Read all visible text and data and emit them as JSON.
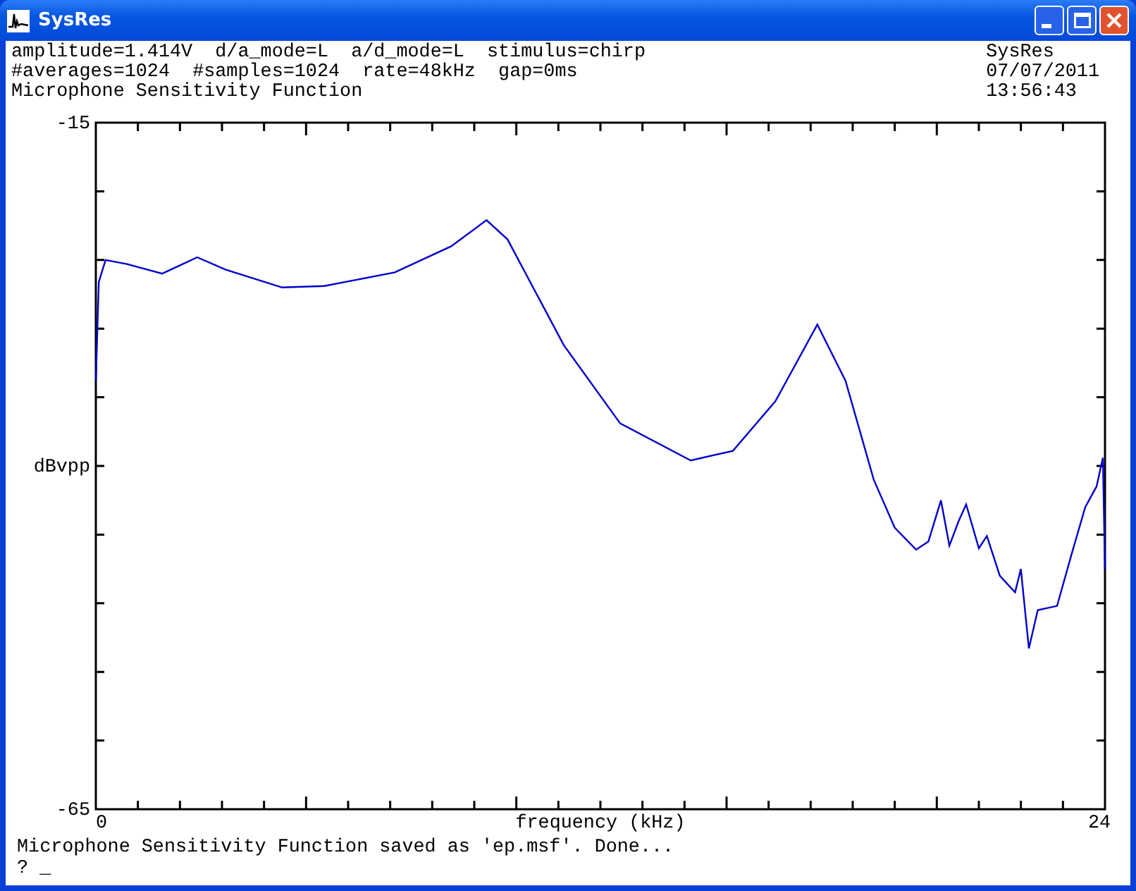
{
  "window": {
    "title": "SysRes"
  },
  "header": {
    "left": [
      "amplitude=1.414V  d/a_mode=L  a/d_mode=L  stimulus=chirp",
      "#averages=1024  #samples=1024  rate=48kHz  gap=0ms",
      "Microphone Sensitivity Function"
    ],
    "right": [
      "SysRes",
      "07/07/2011",
      "13:56:43"
    ]
  },
  "plot": {
    "chart_data": {
      "type": "line",
      "xlabel": "frequency (kHz)",
      "ylabel": "dBvpp",
      "xlim": [
        0,
        24
      ],
      "ylim": [
        -65,
        -15
      ],
      "xticks": [
        0,
        24
      ],
      "yticks": [
        -15,
        -65
      ],
      "x": [
        0,
        0.07,
        0.23,
        0.74,
        1.58,
        2.41,
        3.08,
        4.43,
        5.43,
        7.11,
        8.45,
        9.29,
        9.79,
        11.13,
        12.47,
        14.15,
        15.15,
        16.16,
        17.16,
        17.83,
        18.5,
        19.0,
        19.51,
        19.8,
        20.1,
        20.3,
        20.52,
        20.7,
        21.0,
        21.19,
        21.5,
        21.86,
        22.0,
        22.19,
        22.4,
        22.86,
        23.2,
        23.53,
        23.8,
        23.95,
        24.0
      ],
      "series": [
        {
          "color": "#0000cc",
          "values": [
            -33.8,
            -26.6,
            -25.0,
            -25.3,
            -26.0,
            -24.8,
            -25.7,
            -27.0,
            -26.9,
            -25.9,
            -24.0,
            -22.1,
            -23.5,
            -31.2,
            -36.9,
            -39.6,
            -38.9,
            -35.3,
            -29.7,
            -33.8,
            -41.0,
            -44.5,
            -46.1,
            -45.5,
            -42.5,
            -45.8,
            -44.0,
            -42.8,
            -46.0,
            -45.1,
            -48.0,
            -49.2,
            -47.5,
            -53.3,
            -50.5,
            -50.2,
            -46.5,
            -43.0,
            -41.5,
            -39.4,
            -47.5
          ]
        }
      ]
    }
  },
  "status": {
    "message": "Microphone Sensitivity Function saved as 'ep.msf'. Done...",
    "prompt": "? _"
  }
}
